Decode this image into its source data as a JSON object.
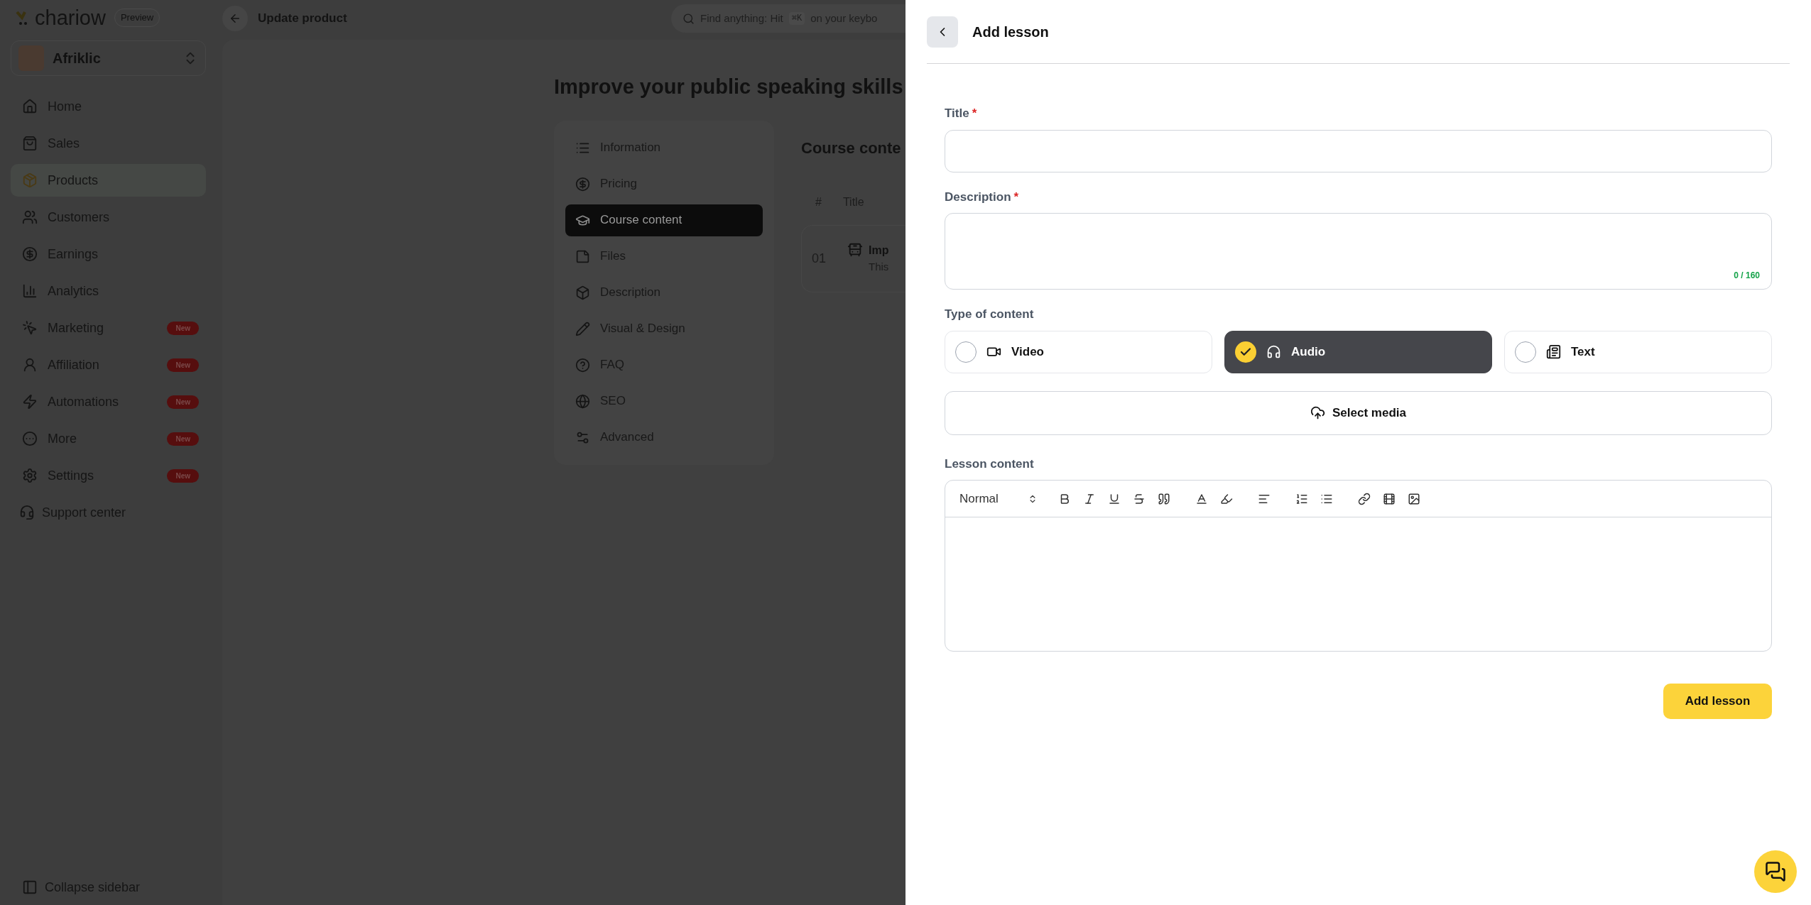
{
  "sidebar": {
    "logo": "chariow",
    "logo_badge": "Preview",
    "workspace": "Afriklic",
    "items": [
      {
        "label": "Home",
        "selected": false
      },
      {
        "label": "Sales",
        "selected": false
      },
      {
        "label": "Products",
        "selected": true
      },
      {
        "label": "Customers",
        "selected": false
      },
      {
        "label": "Earnings",
        "selected": false
      },
      {
        "label": "Analytics",
        "selected": false
      },
      {
        "label": "Marketing",
        "selected": false,
        "badge": "New"
      },
      {
        "label": "Affiliation",
        "selected": false,
        "badge": "New"
      },
      {
        "label": "Automations",
        "selected": false,
        "badge": "New"
      },
      {
        "label": "More",
        "selected": false,
        "badge": "New"
      },
      {
        "label": "Settings",
        "selected": false,
        "badge": "New"
      }
    ],
    "support": "Support center",
    "collapse": "Collapse sidebar"
  },
  "header": {
    "title": "Update product",
    "search": {
      "prefix": "Find anything: Hit",
      "shortcut": "⌘K",
      "suffix": "on your keybo"
    }
  },
  "product": {
    "title": "Improve your public speaking skills",
    "sections": [
      {
        "label": "Information",
        "selected": false
      },
      {
        "label": "Pricing",
        "selected": false
      },
      {
        "label": "Course content",
        "selected": true
      },
      {
        "label": "Files",
        "selected": false
      },
      {
        "label": "Description",
        "selected": false
      },
      {
        "label": "Visual & Design",
        "selected": false
      },
      {
        "label": "FAQ",
        "selected": false
      },
      {
        "label": "SEO",
        "selected": false
      },
      {
        "label": "Advanced",
        "selected": false
      }
    ],
    "content_title": "Course conte",
    "columns": [
      "#",
      "Title"
    ],
    "rows": [
      {
        "number": "01",
        "title": "Imp",
        "subtitle": "This"
      }
    ]
  },
  "panel": {
    "title": "Add lesson",
    "fields": [
      {
        "kind": "input",
        "label": "Title",
        "required_mark": "*"
      },
      {
        "kind": "textarea",
        "label": "Description",
        "required_mark": "*",
        "counter": "0 / 160"
      }
    ],
    "type_label": "Type of content",
    "types": [
      {
        "label": "Video",
        "selected": false
      },
      {
        "label": "Audio",
        "selected": true
      },
      {
        "label": "Text",
        "selected": false
      }
    ],
    "media_button": "Select media",
    "content_label": "Lesson content",
    "editor": {
      "format": "Normal"
    },
    "submit": "Add lesson"
  }
}
